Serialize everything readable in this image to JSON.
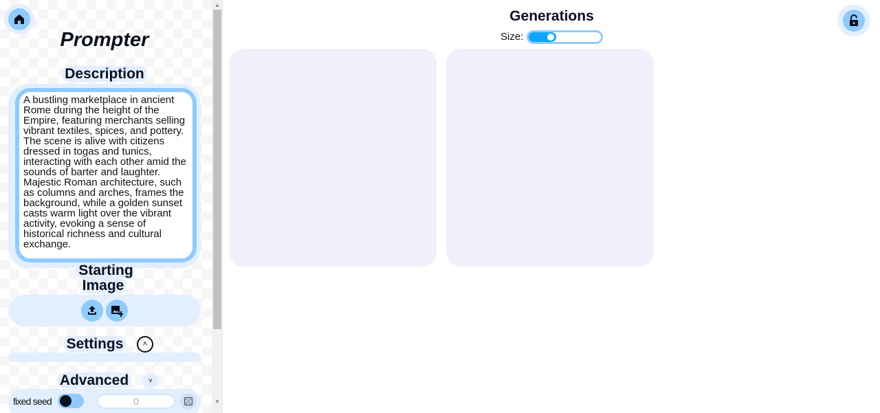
{
  "sidebar": {
    "title": "Prompter",
    "description_heading": "Description",
    "description_text": "A bustling marketplace in ancient Rome during the height of the Empire, featuring merchants selling vibrant textiles, spices, and pottery. The scene is alive with citizens dressed in togas and tunics, interacting with each other amid the sounds of barter and laughter. Majestic Roman architecture, such as columns and arches, frames the background, while a golden sunset casts warm light over the vibrant activity, evoking a sense of historical richness and cultural exchange.",
    "starting_image_heading": "Starting Image",
    "settings_heading": "Settings",
    "advanced_heading": "Advanced",
    "fixed_seed_label": "fixed seed",
    "fixed_seed_on": false,
    "seed_value": "0"
  },
  "main": {
    "title": "Generations",
    "size_label": "Size:",
    "size_value_percent": 25,
    "generation_cards": 2
  },
  "colors": {
    "accent": "#8fcbff",
    "accent_light": "#e3efff",
    "card": "#f0effb",
    "slider_fill": "#0ea5ff"
  }
}
